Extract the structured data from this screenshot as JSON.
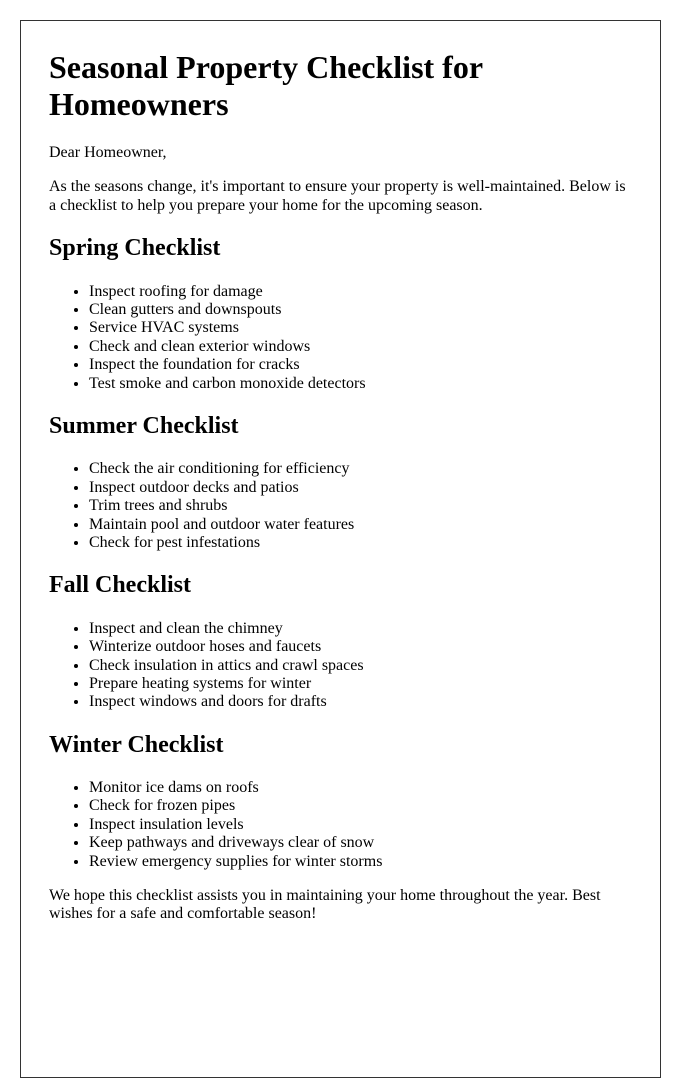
{
  "document": {
    "title": "Seasonal Property Checklist for Homeowners",
    "greeting": "Dear Homeowner,",
    "intro": "As the seasons change, it's important to ensure your property is well-maintained. Below is a checklist to help you prepare your home for the upcoming season.",
    "sections": [
      {
        "heading": "Spring Checklist",
        "items": [
          "Inspect roofing for damage",
          "Clean gutters and downspouts",
          "Service HVAC systems",
          "Check and clean exterior windows",
          "Inspect the foundation for cracks",
          "Test smoke and carbon monoxide detectors"
        ]
      },
      {
        "heading": "Summer Checklist",
        "items": [
          "Check the air conditioning for efficiency",
          "Inspect outdoor decks and patios",
          "Trim trees and shrubs",
          "Maintain pool and outdoor water features",
          "Check for pest infestations"
        ]
      },
      {
        "heading": "Fall Checklist",
        "items": [
          "Inspect and clean the chimney",
          "Winterize outdoor hoses and faucets",
          "Check insulation in attics and crawl spaces",
          "Prepare heating systems for winter",
          "Inspect windows and doors for drafts"
        ]
      },
      {
        "heading": "Winter Checklist",
        "items": [
          "Monitor ice dams on roofs",
          "Check for frozen pipes",
          "Inspect insulation levels",
          "Keep pathways and driveways clear of snow",
          "Review emergency supplies for winter storms"
        ]
      }
    ],
    "closing": "We hope this checklist assists you in maintaining your home throughout the year. Best wishes for a safe and comfortable season!"
  }
}
